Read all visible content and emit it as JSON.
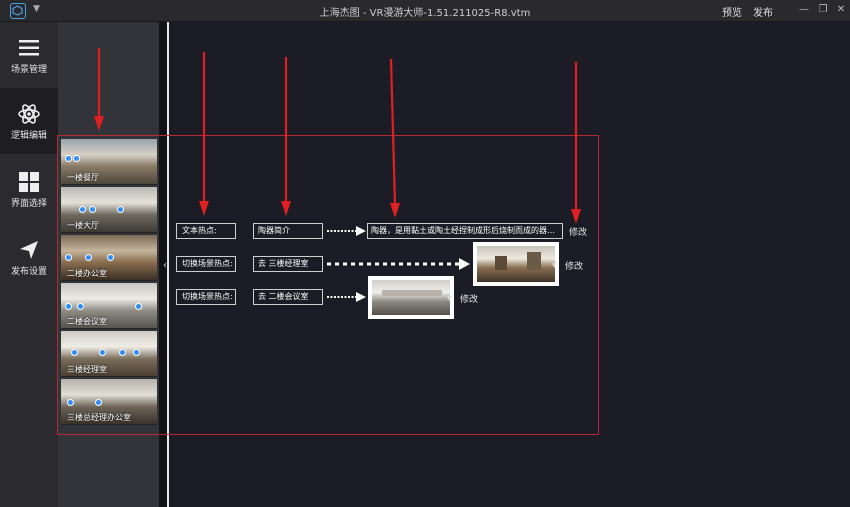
{
  "window": {
    "title": "上海杰图 - VR漫游大师-1.51.211025-R8.vtm",
    "preview_label": "预览",
    "publish_label": "发布"
  },
  "nav": {
    "items": [
      {
        "label": "场景管理",
        "icon": "hamburger-menu-icon"
      },
      {
        "label": "逻辑编辑",
        "icon": "atom-icon"
      },
      {
        "label": "界面选择",
        "icon": "grid-icon"
      },
      {
        "label": "发布设置",
        "icon": "send-arrow-icon"
      }
    ]
  },
  "scenes": [
    {
      "label": "一楼餐厅"
    },
    {
      "label": "一楼大厅"
    },
    {
      "label": "二楼办公室"
    },
    {
      "label": "二楼会议室"
    },
    {
      "label": "三楼经理室"
    },
    {
      "label": "三楼总经理办公室"
    }
  ],
  "hotspots": [
    {
      "type_label": "文本热点:",
      "name": "陶器简介",
      "desc": "陶器，是用黏土或陶土经捏制成形后烧制而成的器具。陶器...",
      "edit_label": "修改"
    },
    {
      "type_label": "切换场景热点:",
      "name": "去 三楼经理室",
      "edit_label": "修改"
    },
    {
      "type_label": "切换场景热点:",
      "name": "去 二楼会议室",
      "edit_label": "修改"
    }
  ],
  "colors": {
    "accent": "#2d8cff",
    "annotation_red": "#e02020",
    "box_red": "#b62a30",
    "background": "#1c1c26"
  }
}
